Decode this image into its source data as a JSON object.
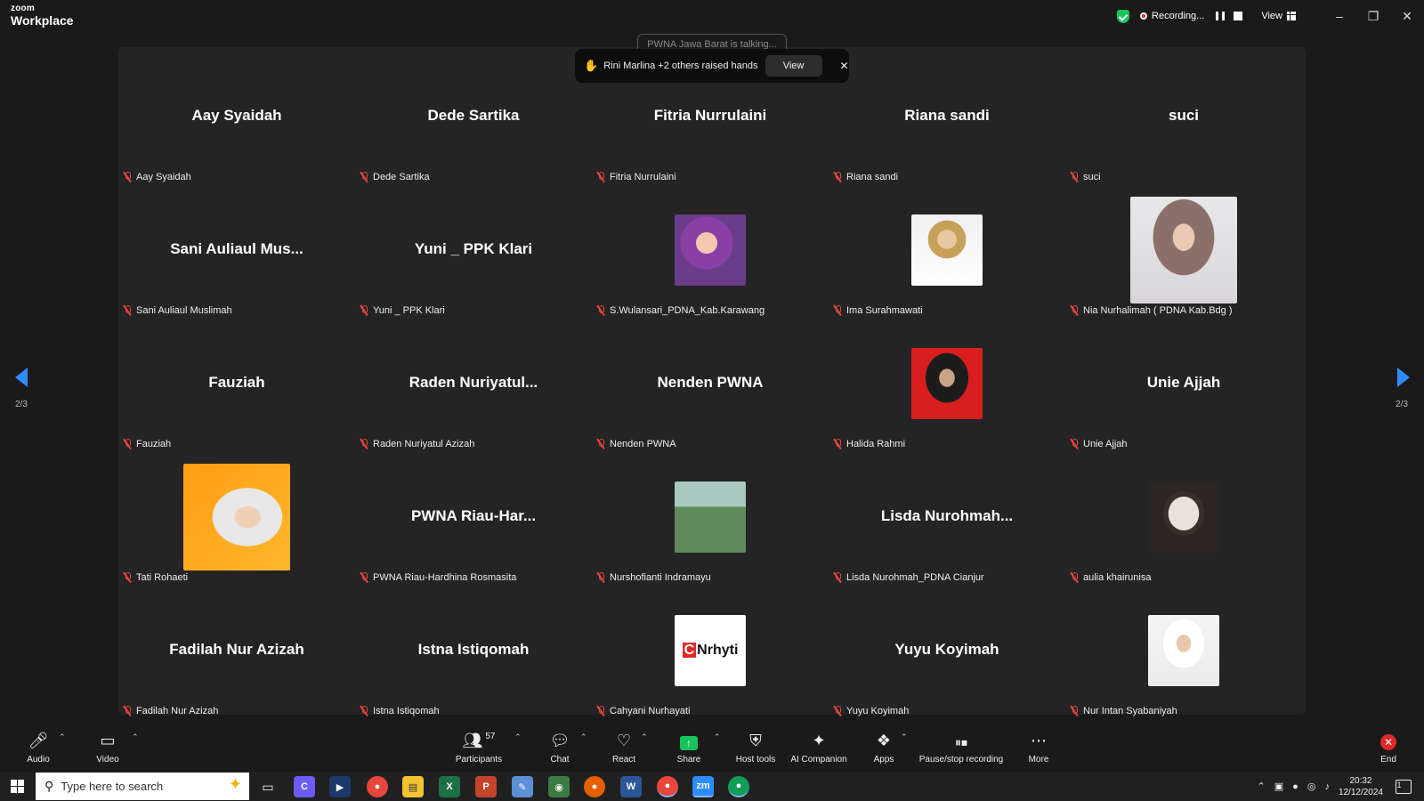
{
  "app": {
    "logo_top": "zoom",
    "logo_bottom": "Workplace"
  },
  "titlebar": {
    "recording_label": "Recording...",
    "view_label": "View"
  },
  "talking_indicator": "PWNA Jawa Barat is talking...",
  "raised_hands": {
    "text": "Rini Marlina +2 others raised hands",
    "view_label": "View"
  },
  "pagination": {
    "left": "2/3",
    "right": "2/3"
  },
  "tiles": [
    {
      "big": "Aay Syaidah",
      "name": "Aay Syaidah",
      "photo": null
    },
    {
      "big": "Dede Sartika",
      "name": "Dede Sartika",
      "photo": null
    },
    {
      "big": "Fitria Nurrulaini",
      "name": "Fitria Nurrulaini",
      "photo": null
    },
    {
      "big": "Riana sandi",
      "name": "Riana sandi",
      "photo": null
    },
    {
      "big": "suci",
      "name": "suci",
      "photo": null
    },
    {
      "big": "Sani  Auliaul  Mus...",
      "name": "Sani Auliaul Muslimah",
      "photo": null
    },
    {
      "big": "Yuni _ PPK Klari",
      "name": "Yuni _ PPK Klari",
      "photo": null
    },
    {
      "big": "",
      "name": "S.Wulansari_PDNA_Kab.Karawang",
      "photo": "purple"
    },
    {
      "big": "",
      "name": "Ima Surahmawati",
      "photo": "white-coat"
    },
    {
      "big": "",
      "name": "Nia Nurhalimah ( PDNA Kab.Bdg )",
      "photo": "hijab-large"
    },
    {
      "big": "Fauziah",
      "name": "Fauziah",
      "photo": null
    },
    {
      "big": "Raden  Nuriyatul...",
      "name": "Raden Nuriyatul Azizah",
      "photo": null
    },
    {
      "big": "Nenden PWNA",
      "name": "Nenden PWNA",
      "photo": null
    },
    {
      "big": "",
      "name": "Halida Rahmi",
      "photo": "red-bg"
    },
    {
      "big": "Unie Ajjah",
      "name": "Unie Ajjah",
      "photo": null
    },
    {
      "big": "",
      "name": "Tati Rohaeti",
      "photo": "orange-large"
    },
    {
      "big": "PWNA  Riau-Har...",
      "name": "PWNA Riau-Hardhina Rosmasita",
      "photo": null
    },
    {
      "big": "",
      "name": "Nurshofianti Indramayu",
      "photo": "garden"
    },
    {
      "big": "Lisda  Nurohmah...",
      "name": "Lisda Nurohmah_PDNA Cianjur",
      "photo": null
    },
    {
      "big": "",
      "name": "aulia khairunisa",
      "photo": "toy"
    },
    {
      "big": "Fadilah Nur Azizah",
      "name": "Fadilah Nur Azizah",
      "photo": null
    },
    {
      "big": "Istna Istiqomah",
      "name": "Istna Istiqomah",
      "photo": null
    },
    {
      "big": "",
      "name": "Cahyani Nurhayati",
      "photo": "logo",
      "logo_text": "Nrhyti"
    },
    {
      "big": "Yuyu Koyimah",
      "name": "Yuyu Koyimah",
      "photo": null
    },
    {
      "big": "",
      "name": "Nur Intan Syabaniyah",
      "photo": "white-hijab"
    }
  ],
  "toolbar": {
    "audio": "Audio",
    "video": "Video",
    "participants": "Participants",
    "participants_count": "57",
    "chat": "Chat",
    "react": "React",
    "share": "Share",
    "host_tools": "Host tools",
    "ai_companion": "AI Companion",
    "apps": "Apps",
    "pause_stop": "Pause/stop recording",
    "more": "More",
    "end": "End"
  },
  "taskbar": {
    "search_placeholder": "Type here to search",
    "time": "20:32",
    "date": "12/12/2024",
    "notification_count": "1"
  }
}
